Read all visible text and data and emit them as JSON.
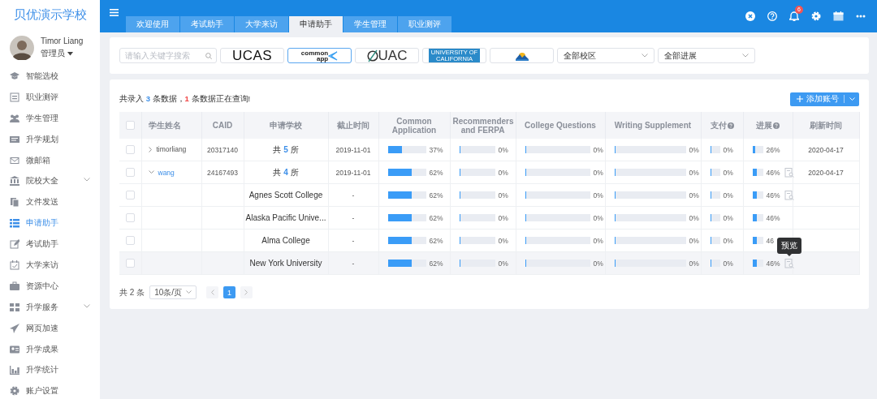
{
  "sidebar": {
    "title": "贝优演示学校",
    "user": {
      "name": "Timor Liang",
      "role": "管理员"
    },
    "items": [
      {
        "label": "智能选校",
        "selected": false,
        "submenu": false
      },
      {
        "label": "职业测评",
        "selected": false,
        "submenu": false
      },
      {
        "label": "学生管理",
        "selected": false,
        "submenu": false
      },
      {
        "label": "升学规划",
        "selected": false,
        "submenu": false
      },
      {
        "label": "微邮箱",
        "selected": false,
        "submenu": false
      },
      {
        "label": "院校大全",
        "selected": false,
        "submenu": true
      },
      {
        "label": "文件发送",
        "selected": false,
        "submenu": false
      },
      {
        "label": "申请助手",
        "selected": true,
        "submenu": false
      },
      {
        "label": "考试助手",
        "selected": false,
        "submenu": false
      },
      {
        "label": "大学来访",
        "selected": false,
        "submenu": false
      },
      {
        "label": "资源中心",
        "selected": false,
        "submenu": false
      },
      {
        "label": "升学服务",
        "selected": false,
        "submenu": true
      },
      {
        "label": "网页加速",
        "selected": false,
        "submenu": false
      },
      {
        "label": "升学成果",
        "selected": false,
        "submenu": false
      },
      {
        "label": "升学统计",
        "selected": false,
        "submenu": false
      },
      {
        "label": "账户设置",
        "selected": false,
        "submenu": false
      }
    ]
  },
  "topbar": {
    "tabs": [
      {
        "label": "欢迎使用",
        "selected": false
      },
      {
        "label": "考试助手",
        "selected": false
      },
      {
        "label": "大学来访",
        "selected": false
      },
      {
        "label": "申请助手",
        "selected": true
      },
      {
        "label": "学生管理",
        "selected": false
      },
      {
        "label": "职业测评",
        "selected": false
      }
    ],
    "notification_count": "6"
  },
  "filters": {
    "search": {
      "placeholder": "请输入关键字搜索"
    },
    "logos": [
      {
        "kind": "ucas",
        "lines": [
          "UCAS"
        ],
        "selected": false
      },
      {
        "kind": "commonapp",
        "lines": [
          "common",
          "app"
        ],
        "selected": true
      },
      {
        "kind": "ouac",
        "lines": [
          "UAC"
        ],
        "selected": false
      },
      {
        "kind": "uc",
        "lines": [
          "UNIVERSITY OF",
          "CALIFORNIA"
        ],
        "selected": false
      },
      {
        "kind": "bc",
        "selected": false
      }
    ],
    "selects": [
      {
        "value": "全部校区"
      },
      {
        "value": "全部进展"
      }
    ]
  },
  "table": {
    "summary": [
      {
        "kind": "text",
        "text": "共录入 "
      },
      {
        "kind": "total",
        "text": "3"
      },
      {
        "kind": "text",
        "text": " 条数据，"
      },
      {
        "kind": "querying",
        "text": "1"
      },
      {
        "kind": "text",
        "text": " 条数据正在查询!"
      }
    ],
    "add_button": "添加账号",
    "select_all_checked": false,
    "columns": [
      {
        "label": "学生姓名"
      },
      {
        "label": "CAID"
      },
      {
        "label": "申请学校"
      },
      {
        "label": "截止时间"
      },
      {
        "label": "Common Application"
      },
      {
        "label": "Recommenders and FERPA"
      },
      {
        "label": "College Questions"
      },
      {
        "label": "Writing Supplement"
      },
      {
        "label": "支付",
        "help": true
      },
      {
        "label": "进展",
        "help": true
      },
      {
        "label": "刷新时间"
      }
    ],
    "students": [
      {
        "name": "timorliang",
        "checked": false,
        "expanded": false,
        "caid": "20317140",
        "schools": "共 **5** 所",
        "deadline": "2019-11-01",
        "common_app": {
          "level": 0.37,
          "reading": "37%"
        },
        "recommenders": {
          "level": 0,
          "reading": "0%"
        },
        "college_questions": {
          "level": 0,
          "reading": "0%"
        },
        "writing_supplement": {
          "level": 0,
          "reading": "0%"
        },
        "payment": {
          "level": 0,
          "reading": "0%"
        },
        "progress": {
          "level": 0.26,
          "reading": "26%"
        },
        "preview": false,
        "refreshed": "2020-04-17"
      },
      {
        "name": "wang",
        "checked": false,
        "expanded": true,
        "caid": "24167493",
        "schools": "共 **4** 所",
        "deadline": "2019-11-01",
        "common_app": {
          "level": 0.62,
          "reading": "62%"
        },
        "recommenders": {
          "level": 0,
          "reading": "0%"
        },
        "college_questions": {
          "level": 0,
          "reading": "0%"
        },
        "writing_supplement": {
          "level": 0,
          "reading": "0%"
        },
        "payment": {
          "level": 0,
          "reading": "0%"
        },
        "progress": {
          "level": 0.46,
          "reading": "46%"
        },
        "preview": true,
        "refreshed": "2020-04-17",
        "children": [
          {
            "school": "Agnes Scott College",
            "checked": false,
            "highlighted": false,
            "deadline": "-",
            "common_app": {
              "level": 0.62,
              "reading": "62%"
            },
            "recommenders": {
              "level": 0,
              "reading": "0%"
            },
            "college_questions": {
              "level": 0,
              "reading": "0%"
            },
            "writing_supplement": {
              "level": 0,
              "reading": "0%"
            },
            "payment": {
              "level": 0,
              "reading": "0%"
            },
            "progress": {
              "level": 0.46,
              "reading": "46%"
            },
            "preview": true
          },
          {
            "school": "Alaska Pacific Unive...",
            "checked": false,
            "highlighted": false,
            "deadline": "-",
            "common_app": {
              "level": 0.62,
              "reading": "62%"
            },
            "recommenders": {
              "level": 0,
              "reading": "0%"
            },
            "college_questions": {
              "level": 0,
              "reading": "0%"
            },
            "writing_supplement": {
              "level": 0,
              "reading": "0%"
            },
            "payment": {
              "level": 0,
              "reading": "0%"
            },
            "progress": {
              "level": 0.46,
              "reading": "46%"
            },
            "preview": false
          },
          {
            "school": "Alma College",
            "checked": false,
            "highlighted": false,
            "deadline": "-",
            "common_app": {
              "level": 0.62,
              "reading": "62%"
            },
            "recommenders": {
              "level": 0,
              "reading": "0%"
            },
            "college_questions": {
              "level": 0,
              "reading": "0%"
            },
            "writing_supplement": {
              "level": 0,
              "reading": "0%"
            },
            "payment": {
              "level": 0,
              "reading": "0%"
            },
            "progress": {
              "level": 0.46,
              "reading": "46"
            },
            "preview": false
          },
          {
            "school": "New York University",
            "checked": false,
            "highlighted": true,
            "deadline": "-",
            "common_app": {
              "level": 0.62,
              "reading": "62%"
            },
            "recommenders": {
              "level": 0,
              "reading": "0%"
            },
            "college_questions": {
              "level": 0,
              "reading": "0%"
            },
            "writing_supplement": {
              "level": 0,
              "reading": "0%"
            },
            "payment": {
              "level": 0,
              "reading": "0%"
            },
            "progress": {
              "level": 0.46,
              "reading": "46%"
            },
            "preview": true,
            "tooltip": "预览"
          }
        ]
      }
    ],
    "pager": {
      "total": "共 2 条",
      "page_size": "10条/页",
      "pages": [
        {
          "label": "1",
          "selected": true
        }
      ]
    }
  }
}
